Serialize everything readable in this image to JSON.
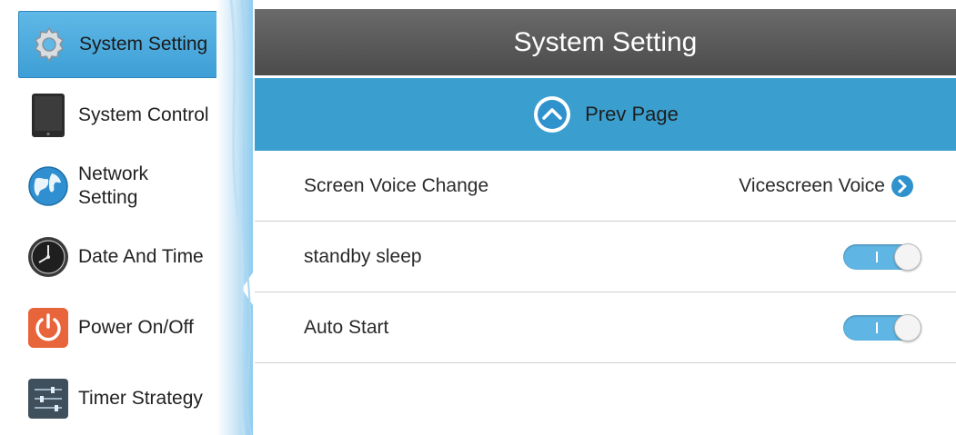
{
  "sidebar": {
    "items": [
      {
        "label": "System Setting",
        "icon": "gear-icon",
        "active": true
      },
      {
        "label": "System Control",
        "icon": "tablet-icon",
        "active": false
      },
      {
        "label": "Network Setting",
        "icon": "globe-icon",
        "active": false
      },
      {
        "label": "Date And Time",
        "icon": "clock-icon",
        "active": false
      },
      {
        "label": "Power On/Off",
        "icon": "power-icon",
        "active": false
      },
      {
        "label": "Timer Strategy",
        "icon": "sliders-icon",
        "active": false
      }
    ]
  },
  "main": {
    "title": "System Setting",
    "prev_page_label": "Prev Page",
    "rows": [
      {
        "label": "Screen Voice Change",
        "value": "Vicescreen Voice"
      },
      {
        "label": "standby sleep",
        "toggle_on": true
      },
      {
        "label": "Auto Start",
        "toggle_on": true
      }
    ]
  },
  "colors": {
    "accent": "#3a9fcf",
    "header": "#555555",
    "active_item": "#4aaae0",
    "toggle_on": "#5fb5e3"
  }
}
